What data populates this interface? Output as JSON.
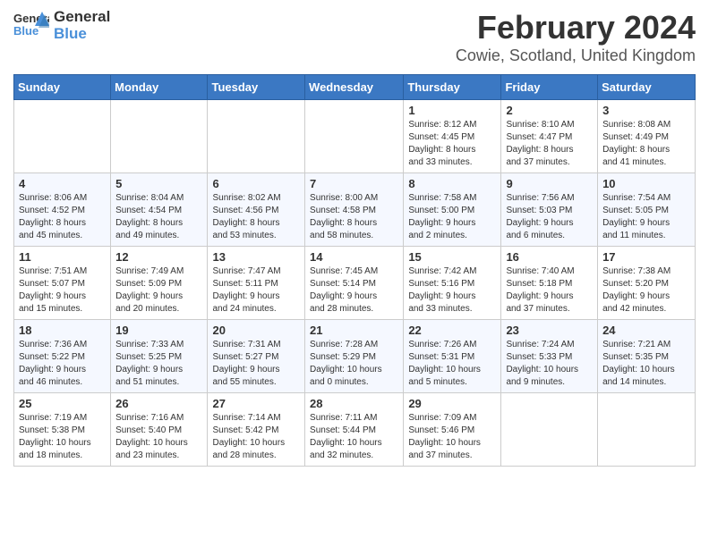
{
  "logo": {
    "general": "General",
    "blue": "Blue"
  },
  "header": {
    "month": "February 2024",
    "location": "Cowie, Scotland, United Kingdom"
  },
  "weekdays": [
    "Sunday",
    "Monday",
    "Tuesday",
    "Wednesday",
    "Thursday",
    "Friday",
    "Saturday"
  ],
  "weeks": [
    [
      {
        "day": "",
        "info": ""
      },
      {
        "day": "",
        "info": ""
      },
      {
        "day": "",
        "info": ""
      },
      {
        "day": "",
        "info": ""
      },
      {
        "day": "1",
        "info": "Sunrise: 8:12 AM\nSunset: 4:45 PM\nDaylight: 8 hours\nand 33 minutes."
      },
      {
        "day": "2",
        "info": "Sunrise: 8:10 AM\nSunset: 4:47 PM\nDaylight: 8 hours\nand 37 minutes."
      },
      {
        "day": "3",
        "info": "Sunrise: 8:08 AM\nSunset: 4:49 PM\nDaylight: 8 hours\nand 41 minutes."
      }
    ],
    [
      {
        "day": "4",
        "info": "Sunrise: 8:06 AM\nSunset: 4:52 PM\nDaylight: 8 hours\nand 45 minutes."
      },
      {
        "day": "5",
        "info": "Sunrise: 8:04 AM\nSunset: 4:54 PM\nDaylight: 8 hours\nand 49 minutes."
      },
      {
        "day": "6",
        "info": "Sunrise: 8:02 AM\nSunset: 4:56 PM\nDaylight: 8 hours\nand 53 minutes."
      },
      {
        "day": "7",
        "info": "Sunrise: 8:00 AM\nSunset: 4:58 PM\nDaylight: 8 hours\nand 58 minutes."
      },
      {
        "day": "8",
        "info": "Sunrise: 7:58 AM\nSunset: 5:00 PM\nDaylight: 9 hours\nand 2 minutes."
      },
      {
        "day": "9",
        "info": "Sunrise: 7:56 AM\nSunset: 5:03 PM\nDaylight: 9 hours\nand 6 minutes."
      },
      {
        "day": "10",
        "info": "Sunrise: 7:54 AM\nSunset: 5:05 PM\nDaylight: 9 hours\nand 11 minutes."
      }
    ],
    [
      {
        "day": "11",
        "info": "Sunrise: 7:51 AM\nSunset: 5:07 PM\nDaylight: 9 hours\nand 15 minutes."
      },
      {
        "day": "12",
        "info": "Sunrise: 7:49 AM\nSunset: 5:09 PM\nDaylight: 9 hours\nand 20 minutes."
      },
      {
        "day": "13",
        "info": "Sunrise: 7:47 AM\nSunset: 5:11 PM\nDaylight: 9 hours\nand 24 minutes."
      },
      {
        "day": "14",
        "info": "Sunrise: 7:45 AM\nSunset: 5:14 PM\nDaylight: 9 hours\nand 28 minutes."
      },
      {
        "day": "15",
        "info": "Sunrise: 7:42 AM\nSunset: 5:16 PM\nDaylight: 9 hours\nand 33 minutes."
      },
      {
        "day": "16",
        "info": "Sunrise: 7:40 AM\nSunset: 5:18 PM\nDaylight: 9 hours\nand 37 minutes."
      },
      {
        "day": "17",
        "info": "Sunrise: 7:38 AM\nSunset: 5:20 PM\nDaylight: 9 hours\nand 42 minutes."
      }
    ],
    [
      {
        "day": "18",
        "info": "Sunrise: 7:36 AM\nSunset: 5:22 PM\nDaylight: 9 hours\nand 46 minutes."
      },
      {
        "day": "19",
        "info": "Sunrise: 7:33 AM\nSunset: 5:25 PM\nDaylight: 9 hours\nand 51 minutes."
      },
      {
        "day": "20",
        "info": "Sunrise: 7:31 AM\nSunset: 5:27 PM\nDaylight: 9 hours\nand 55 minutes."
      },
      {
        "day": "21",
        "info": "Sunrise: 7:28 AM\nSunset: 5:29 PM\nDaylight: 10 hours\nand 0 minutes."
      },
      {
        "day": "22",
        "info": "Sunrise: 7:26 AM\nSunset: 5:31 PM\nDaylight: 10 hours\nand 5 minutes."
      },
      {
        "day": "23",
        "info": "Sunrise: 7:24 AM\nSunset: 5:33 PM\nDaylight: 10 hours\nand 9 minutes."
      },
      {
        "day": "24",
        "info": "Sunrise: 7:21 AM\nSunset: 5:35 PM\nDaylight: 10 hours\nand 14 minutes."
      }
    ],
    [
      {
        "day": "25",
        "info": "Sunrise: 7:19 AM\nSunset: 5:38 PM\nDaylight: 10 hours\nand 18 minutes."
      },
      {
        "day": "26",
        "info": "Sunrise: 7:16 AM\nSunset: 5:40 PM\nDaylight: 10 hours\nand 23 minutes."
      },
      {
        "day": "27",
        "info": "Sunrise: 7:14 AM\nSunset: 5:42 PM\nDaylight: 10 hours\nand 28 minutes."
      },
      {
        "day": "28",
        "info": "Sunrise: 7:11 AM\nSunset: 5:44 PM\nDaylight: 10 hours\nand 32 minutes."
      },
      {
        "day": "29",
        "info": "Sunrise: 7:09 AM\nSunset: 5:46 PM\nDaylight: 10 hours\nand 37 minutes."
      },
      {
        "day": "",
        "info": ""
      },
      {
        "day": "",
        "info": ""
      }
    ]
  ]
}
